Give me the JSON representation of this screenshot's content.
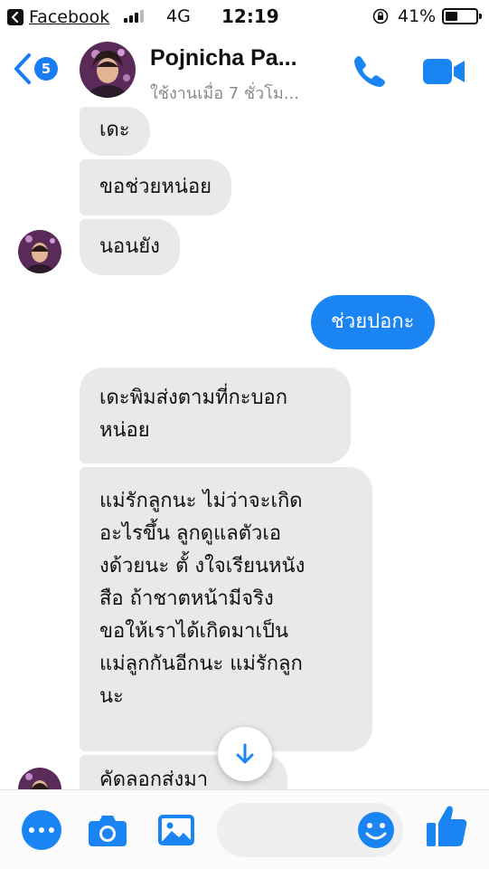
{
  "status_bar": {
    "back_app": "Facebook",
    "network": "4G",
    "time": "12:19",
    "battery_percent": "41%",
    "battery_level": 0.41
  },
  "header": {
    "unread_count": "5",
    "contact_name": "Pojnicha Pa...",
    "last_active": "ใช้งานเมื่อ 7 ชั่วโม...",
    "accent_color": "#1a85f2"
  },
  "messages": [
    {
      "direction": "in",
      "lines": [
        "เดะ"
      ]
    },
    {
      "direction": "in",
      "lines": [
        "ขอช่วยหน่อย"
      ]
    },
    {
      "direction": "in",
      "lines": [
        "นอนยัง"
      ]
    },
    {
      "direction": "out",
      "lines": [
        "ช่วยปอกะ"
      ]
    },
    {
      "direction": "in",
      "lines": [
        "เดะพิมส่งตามที่กะบอก",
        "หน่อย"
      ]
    },
    {
      "direction": "in",
      "lines": [
        "แม่รักลูกนะ ไม่ว่าจะเกิด",
        "อะไรขึ้น ลูกดูแลตัวเอ",
        "งด้วยนะ ตั้ งใจเรียนหนัง",
        "สือ ถ้าชาตหน้ามีจริง",
        "ขอให้เราได้เกิดมาเป็น",
        "แม่ลูกกันอีกนะ แม่รักลูก",
        "นะ"
      ]
    },
    {
      "direction": "in",
      "lines": [
        "คัดลอกส่งมา"
      ]
    }
  ],
  "composer": {
    "icons": [
      "more-icon",
      "camera-icon",
      "gallery-icon",
      "emoji-icon",
      "thumbs-up-icon"
    ]
  }
}
